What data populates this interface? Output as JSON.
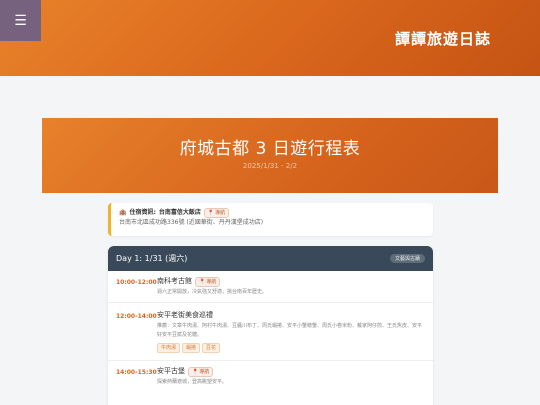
{
  "app": {
    "menu_icon": "☰",
    "site_title": "譚譚旅遊日誌"
  },
  "header": {
    "title": "府城古都 3 日遊行程表",
    "subtitle": "2025/1/31 - 2/2"
  },
  "hotel": {
    "label": "住宿資訊:",
    "name": "台南富信大飯店",
    "nav_label": "導航",
    "address": "台南市北區成功路336號 (近國華街、丹丹漢堡成功店)"
  },
  "day1": {
    "title": "Day 1: 1/31 (週六)",
    "area_badge": "文藝與古蹟",
    "slots": [
      {
        "time": "10:00-12:00",
        "name": "南科考古館",
        "nav_label": "導航",
        "desc": "週六正常開放，冷氣強又舒適，挑台南百年歷史。"
      },
      {
        "time": "12:00-14:00",
        "name": "安平老街美食巡禮",
        "desc": "推薦：文章牛肉湯、阿村牛肉湯、豆醬川布丁、周氏蝦捲、安平小蟹螃蟹、周氏小卷米粉、戴家阿仔煎、王氏魚皮、安平好安平豆腐及花糖。",
        "tags": [
          "牛肉湯",
          "蝦捲",
          "豆花"
        ]
      },
      {
        "time": "14:00-15:30",
        "name": "安平古堡",
        "nav_label": "導航",
        "desc": "探索熱蘭遮城，登高眺望安平。"
      }
    ]
  },
  "colors": {
    "accent": "#d9661c",
    "menu_bg": "#76617f",
    "day_header_bg": "#39495a",
    "hotel_border": "#f0b429"
  }
}
